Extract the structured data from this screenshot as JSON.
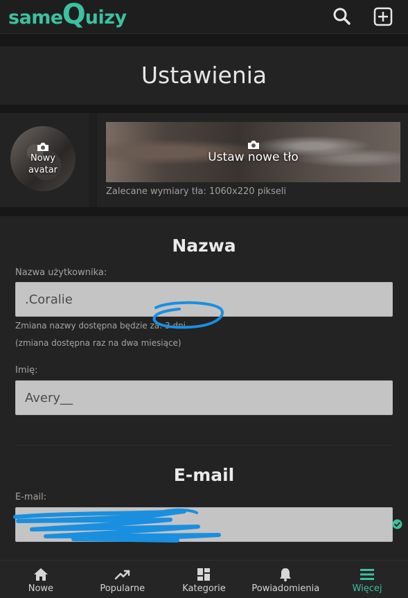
{
  "header": {
    "logo_parts": [
      "same",
      "Q",
      "uizy"
    ],
    "search_icon": "search-icon",
    "add_icon": "plus-square-icon"
  },
  "page": {
    "title": "Ustawienia"
  },
  "avatar": {
    "label_line1": "Nowy",
    "label_line2": "avatar",
    "icon": "camera-icon"
  },
  "background": {
    "label": "Ustaw nowe tło",
    "hint": "Zalecane wymiary tła: 1060x220 pikseli",
    "icon": "camera-icon"
  },
  "name_section": {
    "title": "Nazwa",
    "username_label": "Nazwa użytkownika:",
    "username_value": ".Coralie",
    "rename_info": "Zmiana nazwy dostępna będzie za: 3 dni",
    "rename_note": "(zmiana dostępna raz na dwa miesiące)",
    "first_name_label": "Imię:",
    "first_name_value": "Avery__"
  },
  "email_section": {
    "title": "E-mail",
    "email_label": "E-mail:",
    "email_value": "",
    "verified_icon": "check-circle-icon"
  },
  "bottom_nav": {
    "items": [
      {
        "label": "Nowe",
        "icon": "home-icon"
      },
      {
        "label": "Popularne",
        "icon": "trending-icon"
      },
      {
        "label": "Kategorie",
        "icon": "grid-icon"
      },
      {
        "label": "Powiadomienia",
        "icon": "bell-icon"
      },
      {
        "label": "Więcej",
        "icon": "menu-icon"
      }
    ],
    "active_index": 4
  },
  "colors": {
    "accent": "#3cc0a0",
    "background": "#1e1e1e",
    "panel": "#232323",
    "input": "#c4c4c4",
    "scribble": "#1a8fe0"
  }
}
